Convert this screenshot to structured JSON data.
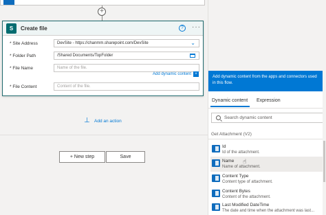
{
  "card": {
    "title": "Create file",
    "fields": [
      {
        "label": "* Site Address",
        "value": "DevSite - https://chanmm.sharepoint.com/DevSite",
        "placeholder": ""
      },
      {
        "label": "* Folder Path",
        "value": "/Shared Documents/TopFolder",
        "placeholder": ""
      },
      {
        "label": "* File Name",
        "value": "",
        "placeholder": "Name of the file."
      },
      {
        "label": "* File Content",
        "value": "",
        "placeholder": "Content of the file."
      }
    ],
    "add_dynamic_content": "Add dynamic content",
    "badge": "+"
  },
  "canvas": {
    "add_action": "Add an action",
    "new_step": "+ New step",
    "save": "Save"
  },
  "panel": {
    "banner": "Add dynamic content from the apps and connectors used in this flow.",
    "tabs": [
      "Dynamic content",
      "Expression"
    ],
    "search_placeholder": "Search dynamic content",
    "section": "Get Attachment (V2)",
    "items": [
      {
        "name": "Id",
        "desc": "Id of the attachment."
      },
      {
        "name": "Name",
        "desc": "Name of attachment."
      },
      {
        "name": "Content Type",
        "desc": "Content type of attachment."
      },
      {
        "name": "Content Bytes",
        "desc": "Content of the attachment."
      },
      {
        "name": "Last Modified DateTime",
        "desc": "The date and time when the attachment was last..."
      }
    ]
  },
  "colors": {
    "accent": "#0078d4",
    "sharepoint": "#036c70",
    "card_border": "#1f6a6e"
  }
}
